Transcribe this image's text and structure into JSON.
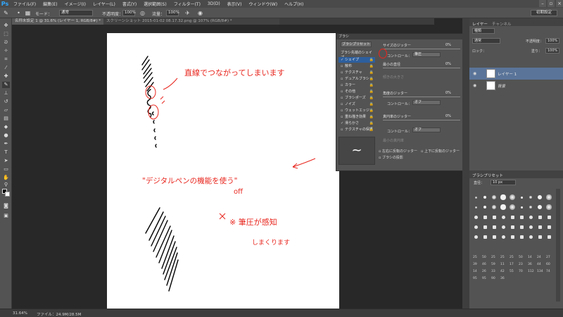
{
  "app": {
    "logo": "Ps",
    "menu": [
      "ファイル(F)",
      "編集(E)",
      "イメージ(I)",
      "レイヤー(L)",
      "書式(Y)",
      "選択範囲(S)",
      "フィルター(T)",
      "3D(D)",
      "表示(V)",
      "ウィンドウ(W)",
      "ヘルプ(H)"
    ],
    "window_controls": [
      "–",
      "▫",
      "×"
    ]
  },
  "options_bar": {
    "mode_label": "モード：",
    "mode_value": "通常",
    "opacity_label": "不透明度：",
    "opacity_value": "100%",
    "flow_label": "流量：",
    "flow_value": "100%",
    "workspace": "初期設定"
  },
  "tabs": [
    {
      "label": "名称未設定 1 @ 31.6% (レイヤー 1, RGB/8#) *"
    },
    {
      "label": "スクリーンショット 2015-01-02 08.17.32.png @ 107% (RGB/8#) *"
    }
  ],
  "canvas": {
    "annotation_top": "直線でつながってしまいます",
    "annotation_mid": "\"デジタルペンの機能を使う\"",
    "annotation_off": "off",
    "annotation_note1": "※ 筆圧が感知",
    "annotation_note2": "しまくります"
  },
  "brush_panel": {
    "title": "ブラシ",
    "preset_button": "ブラシプリセット",
    "list_header": "ブラシ先端のシェイプ",
    "options": [
      {
        "label": "シェイプ",
        "checked": true
      },
      {
        "label": "散布",
        "checked": false
      },
      {
        "label": "テクスチャ",
        "checked": false
      },
      {
        "label": "デュアルブラシ",
        "checked": false
      },
      {
        "label": "カラー",
        "checked": false
      },
      {
        "label": "その他",
        "checked": false
      },
      {
        "label": "ブラシポーズ",
        "checked": false
      },
      {
        "label": "ノイズ",
        "checked": false
      },
      {
        "label": "ウェットエッジ",
        "checked": false
      },
      {
        "label": "重ね描き効果",
        "checked": false
      },
      {
        "label": "滑らかさ",
        "checked": true
      },
      {
        "label": "テクスチャの保護",
        "checked": false
      }
    ],
    "size_jitter_label": "サイズのジッター",
    "size_jitter_value": "0%",
    "control_label": "コントロール：",
    "control_value_1": "筆圧",
    "min_diameter_label": "最小の直径",
    "min_diameter_value": "0%",
    "tilt_scale_label": "傾きの大きさ",
    "angle_jitter_label": "角度のジッター",
    "angle_jitter_value": "0%",
    "control_value_2": "オフ",
    "roundness_jitter_label": "真円率のジッター",
    "roundness_jitter_value": "0%",
    "control_value_3": "オフ",
    "min_roundness_label": "最小の真円率",
    "flip_x_label": "左右に反転のジッター",
    "flip_y_label": "上下に反転のジッター",
    "projection_label": "ブラシの投影",
    "preview_glyph": "~"
  },
  "layers_panel": {
    "tab_layers": "レイヤー",
    "tab_channels": "チャンネル",
    "kind_label": "種類",
    "blend_mode": "通常",
    "opacity_label": "不透明度：",
    "opacity_value": "100%",
    "lock_label": "ロック：",
    "fill_label": "塗り：",
    "fill_value": "100%",
    "layers": [
      {
        "name": "レイヤー 1"
      },
      {
        "name": "背景"
      }
    ]
  },
  "preset_panel": {
    "title": "ブラシプリセット",
    "size_label": "直径：",
    "size_value": "10 px",
    "numbers": [
      "25",
      "50",
      "25",
      "25",
      "25",
      "50",
      "14",
      "24",
      "27",
      "39",
      "46",
      "59",
      "11",
      "17",
      "23",
      "36",
      "44",
      "60",
      "14",
      "26",
      "33",
      "42",
      "55",
      "70",
      "112",
      "134",
      "74",
      "95",
      "95",
      "90",
      "36"
    ]
  },
  "status": {
    "zoom": "31.64%",
    "file_info": "ファイル：24.9M/28.5M"
  }
}
